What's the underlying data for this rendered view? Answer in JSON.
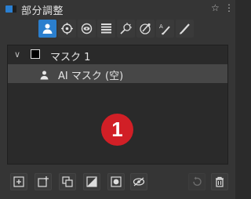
{
  "header": {
    "title": "部分調整",
    "star": "☆",
    "menu": "⋮"
  },
  "toolbar": {
    "items": [
      {
        "icon": "person-mask-icon",
        "active": true
      },
      {
        "icon": "crosshair-target-icon"
      },
      {
        "icon": "eye-ring-icon"
      },
      {
        "icon": "lines-stack-icon"
      },
      {
        "icon": "magic-wand-icon"
      },
      {
        "icon": "color-picker-icon"
      },
      {
        "icon": "text-brush-icon"
      },
      {
        "icon": "brush-icon"
      }
    ],
    "accent": "#2b7fce"
  },
  "layers": {
    "mask_label": "マスク 1",
    "ai_label": "AI マスク (空)"
  },
  "badge": {
    "number": "1",
    "color": "#d11f26"
  },
  "bottom": {
    "buttons": [
      "add-layer-icon",
      "add-mask-icon",
      "duplicate-icon",
      "invert-icon",
      "record-mask-icon",
      "eye-hide-icon",
      "undo-icon",
      "trash-icon"
    ]
  }
}
